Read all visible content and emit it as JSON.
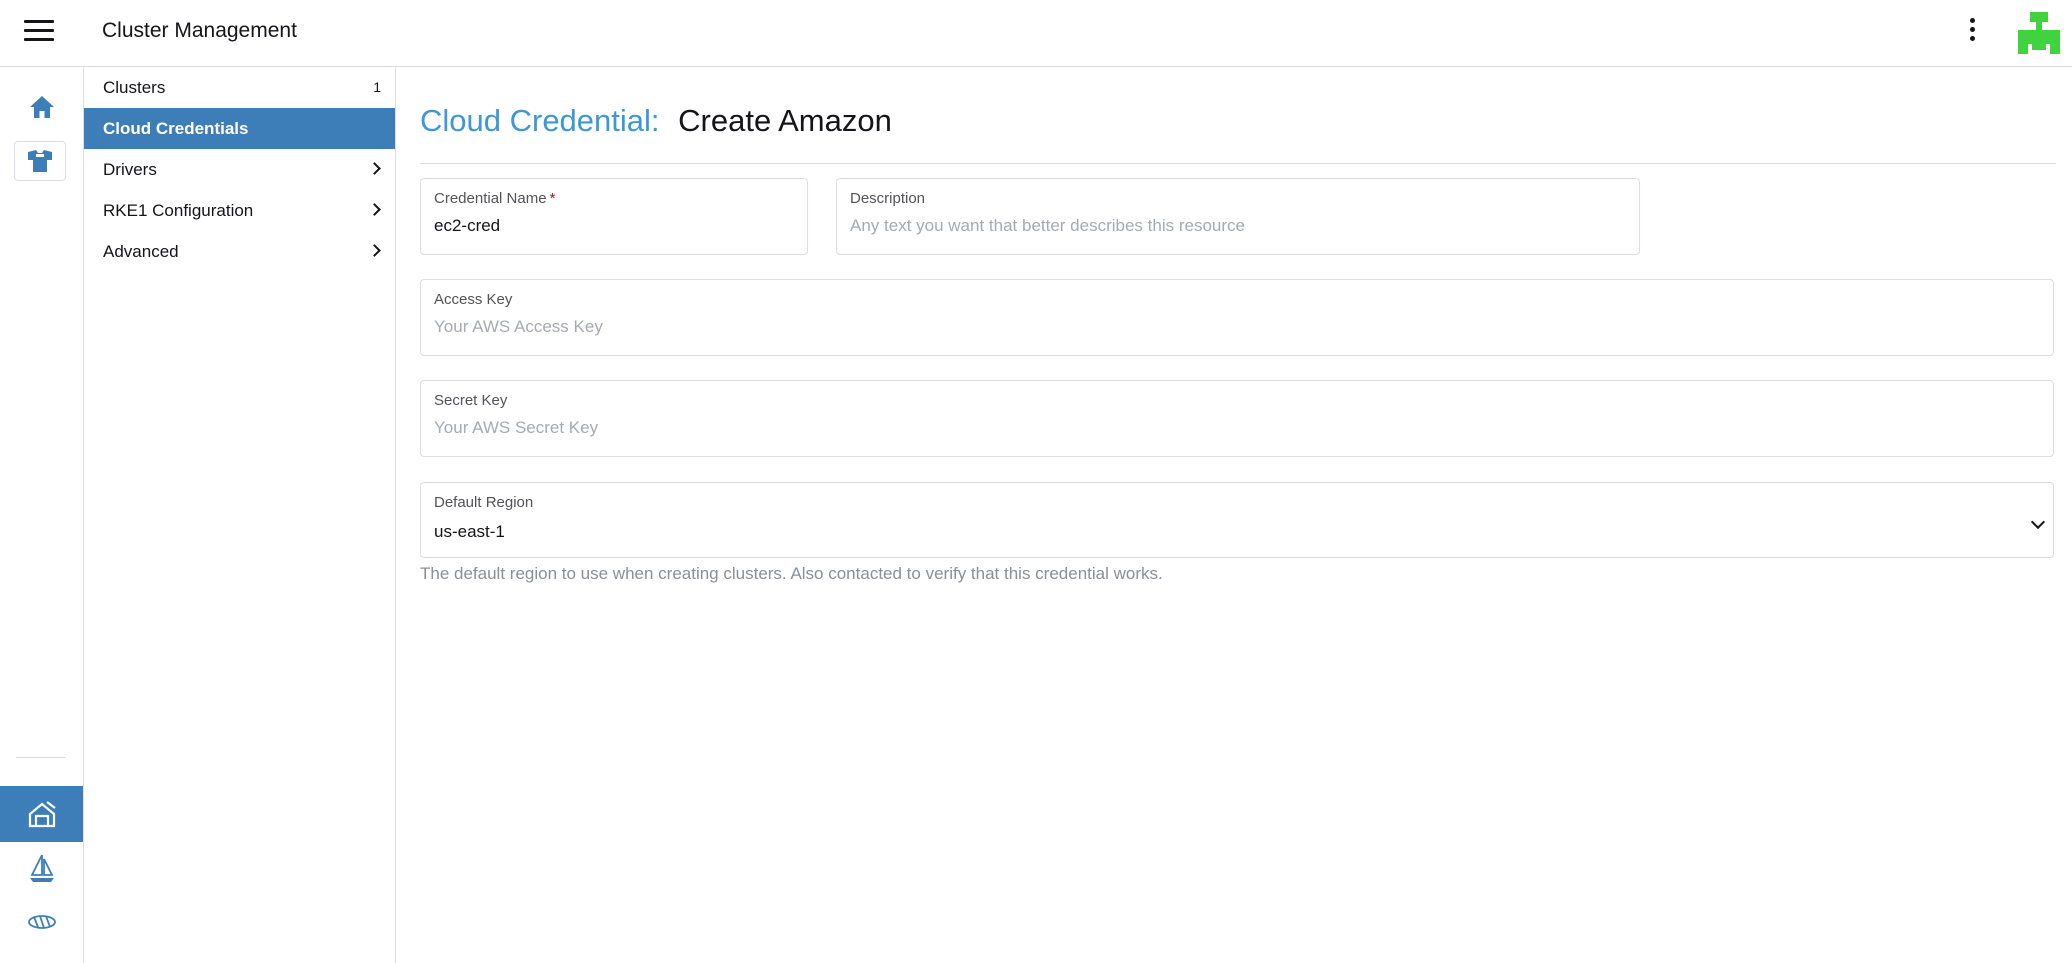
{
  "header": {
    "app_title": "Cluster Management",
    "menu_icon": "hamburger-menu-icon",
    "more_icon": "kebab-more-icon",
    "avatar_color": "#3fd43f"
  },
  "rail": {
    "items": [
      {
        "icon": "home-icon"
      },
      {
        "icon": "shirt-icon"
      },
      {
        "icon": "cluster-management-icon",
        "active": true
      },
      {
        "icon": "fleet-sailboat-icon"
      },
      {
        "icon": "virtualization-icon"
      }
    ]
  },
  "sidenav": {
    "items": [
      {
        "label": "Clusters",
        "count": "1"
      },
      {
        "label": "Cloud Credentials",
        "active": true
      },
      {
        "label": "Drivers"
      },
      {
        "label": "RKE1 Configuration"
      },
      {
        "label": "Advanced"
      }
    ]
  },
  "page": {
    "crumb": "Cloud Credential:",
    "title": "Create Amazon"
  },
  "form": {
    "credential_name": {
      "label": "Credential Name",
      "required_mark": "*",
      "value": "ec2-cred"
    },
    "description": {
      "label": "Description",
      "placeholder": "Any text you want that better describes this resource"
    },
    "access_key": {
      "label": "Access Key",
      "placeholder": "Your AWS Access Key"
    },
    "secret_key": {
      "label": "Secret Key",
      "placeholder": "Your AWS Secret Key"
    },
    "default_region": {
      "label": "Default Region",
      "value": "us-east-1"
    },
    "region_help": "The default region to use when creating clusters. Also contacted to verify that this credential works."
  },
  "colors": {
    "accent": "#3d7eb9",
    "crumb": "#3d98d3",
    "required": "#d0021b"
  }
}
